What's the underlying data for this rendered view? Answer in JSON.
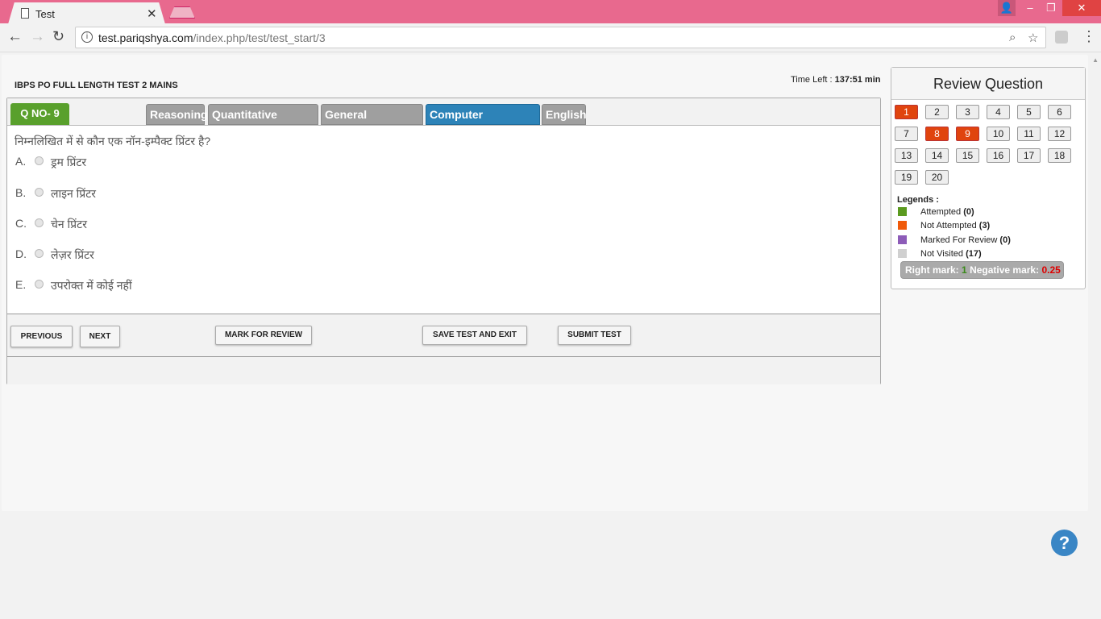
{
  "browser": {
    "tab_title": "Test",
    "url_host": "test.pariqshya.com",
    "url_path": "/index.php/test/test_start/3"
  },
  "test": {
    "title": "IBPS PO FULL LENGTH TEST 2 MAINS",
    "time_left_label": "Time Left :",
    "time_left_value": "137:51 min",
    "qno": "Q NO- 9",
    "sections": [
      "Reasoning",
      "Quantitative Aptitude",
      "General Awareness",
      "Computer Knowledge",
      "English"
    ],
    "active_section": "Computer Knowledge",
    "question": "निम्नलिखित में से कौन एक नॉन-इम्पैक्ट प्रिंटर है?",
    "options": [
      {
        "letter": "A.",
        "text": "ड्रम प्रिंटर"
      },
      {
        "letter": "B.",
        "text": "लाइन प्रिंटर"
      },
      {
        "letter": "C.",
        "text": "चेन प्रिंटर"
      },
      {
        "letter": "D.",
        "text": "लेज़र प्रिंटर"
      },
      {
        "letter": "E.",
        "text": "उपरोक्त में कोई नहीं"
      }
    ],
    "buttons": {
      "previous": "PREVIOUS",
      "next": "NEXT",
      "mark_review": "MARK FOR REVIEW",
      "save_exit": "SAVE TEST AND EXIT",
      "submit": "SUBMIT TEST"
    }
  },
  "review": {
    "heading": "Review Question",
    "questions": [
      "1",
      "2",
      "3",
      "4",
      "5",
      "6",
      "7",
      "8",
      "9",
      "10",
      "11",
      "12",
      "13",
      "14",
      "15",
      "16",
      "17",
      "18",
      "19",
      "20"
    ],
    "not_attempted": [
      "1",
      "8",
      "9"
    ],
    "legends_title": "Legends :",
    "legends": [
      {
        "label": "Attempted",
        "count": "(0)",
        "color": "#5b9a1f"
      },
      {
        "label": "Not Attempted",
        "count": "(3)",
        "color": "#f05a0a"
      },
      {
        "label": "Marked For Review",
        "count": "(0)",
        "color": "#8d5cb8"
      },
      {
        "label": "Not Visited",
        "count": "(17)",
        "color": "#d0d0d0"
      }
    ],
    "right_mark_label": "Right mark:",
    "right_mark_value": "1",
    "negative_mark_label": "Negative mark:",
    "negative_mark_value": "0.25"
  }
}
